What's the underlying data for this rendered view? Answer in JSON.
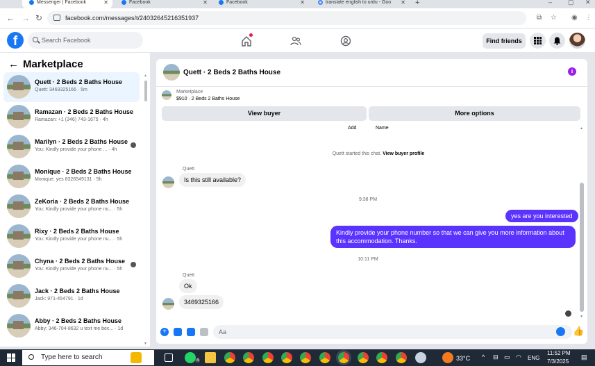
{
  "browser": {
    "tabs": [
      {
        "label": "Messenger | Facebook",
        "active": true
      },
      {
        "label": "Facebook",
        "active": false
      },
      {
        "label": "Facebook",
        "active": false
      },
      {
        "label": "translate english to urdu - Goo",
        "active": false
      }
    ],
    "url": "facebook.com/messages/t/24032645216351937"
  },
  "header": {
    "search_placeholder": "Search Facebook",
    "find_friends": "Find friends"
  },
  "sidebar": {
    "title": "Marketplace",
    "conversations": [
      {
        "name": "Quett · 2 Beds 2 Baths House",
        "preview": "Quett: 3469325166 · 5m",
        "active": true
      },
      {
        "name": "Ramazan · 2 Beds 2 Baths House",
        "preview": "Ramazan: +1 (346) 743-1675 · 4h"
      },
      {
        "name": "Marilyn · 2 Beds 2 Baths House",
        "preview": "You: Kindly provide your phone ... · 4h"
      },
      {
        "name": "Monique · 2 Beds 2 Baths House",
        "preview": "Monique: yes 8326549131 · 5h"
      },
      {
        "name": "ZeKoria · 2 Beds 2 Baths House",
        "preview": "You: Kindly provide your phone nu... · 5h"
      },
      {
        "name": "Rixy · 2 Beds 2 Baths House",
        "preview": "You: Kindly provide your phone nu... · 5h"
      },
      {
        "name": "Chyna · 2 Beds 2 Baths House",
        "preview": "You: Kindly provide your phone nu... · 5h"
      },
      {
        "name": "Jack · 2 Beds 2 Baths House",
        "preview": "Jack: 971-454791 · 1d"
      },
      {
        "name": "Abby · 2 Beds 2 Baths House",
        "preview": "Abby: 346-704-8632 u text me bec... · 1d"
      }
    ]
  },
  "chat": {
    "title": "Quett · 2 Beds 2 Baths House",
    "listing_label": "Marketplace",
    "listing_price": "$910 · 2 Beds 2 Baths House",
    "view_buyer": "View buyer",
    "more_options": "More options",
    "col_add": "Add",
    "col_name": "Name",
    "started_text": "Quett started this chat. ",
    "view_buyer_profile": "View buyer profile",
    "sender_1": "Quett",
    "msg_in_1": "Is this still available?",
    "time_1": "9:38 PM",
    "msg_out_1": "yes are you interested",
    "msg_out_2": "Kindly provide your phone number so that we can give you more information about this accommodation. Thanks.",
    "time_2": "10:11 PM",
    "sender_2": "Quett",
    "msg_in_2": "Ok",
    "msg_in_3": "3469325166",
    "composer_placeholder": "Aa"
  },
  "taskbar": {
    "search_placeholder": "Type here to search",
    "temperature": "33°C",
    "language": "ENG",
    "time": "11:52 PM",
    "date": "7/3/2025",
    "badge": "4"
  }
}
